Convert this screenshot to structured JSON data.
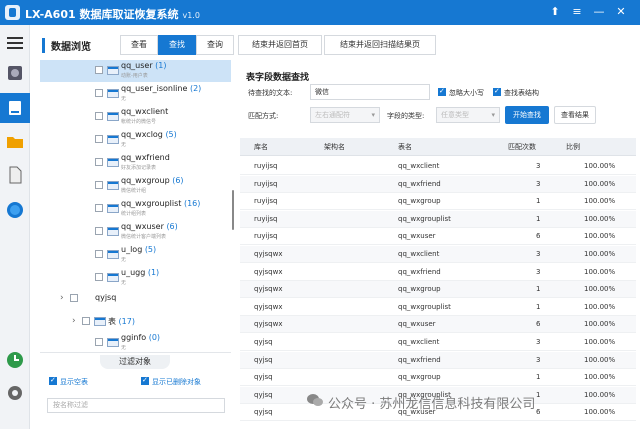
{
  "app": {
    "title": "LX-A601 数据库取证恢复系统",
    "version": "v1.0"
  },
  "window_controls": {
    "pin": "⬆",
    "menu": "≡",
    "minimize": "—",
    "close": "✕"
  },
  "leftbar_icons": [
    "menu-icon",
    "disk-icon",
    "drive-icon",
    "folder-icon",
    "document-icon",
    "globe-icon",
    "clock-icon",
    "settings-icon"
  ],
  "nav": {
    "title": "数据浏览",
    "tabs": [
      "查看",
      "查找",
      "查询",
      "结束并返回首页",
      "结束并返回扫描结果页"
    ],
    "active_tab": "查找"
  },
  "tree": {
    "items": [
      {
        "name": "qq_user",
        "count": "(1)",
        "desc": "动账-用户表"
      },
      {
        "name": "qq_user_isonline",
        "count": "(2)",
        "desc": "无"
      },
      {
        "name": "qq_wxclient",
        "count": "",
        "desc": "帐统计的微信号"
      },
      {
        "name": "qq_wxclog",
        "count": "(5)",
        "desc": "无"
      },
      {
        "name": "qq_wxfriend",
        "count": "",
        "desc": "好友添加记录表"
      },
      {
        "name": "qq_wxgroup",
        "count": "(6)",
        "desc": "微信统计组"
      },
      {
        "name": "qq_wxgrouplist",
        "count": "(16)",
        "desc": "统计组列表"
      },
      {
        "name": "qq_wxuser",
        "count": "(6)",
        "desc": "微信统计客户端列表"
      },
      {
        "name": "u_log",
        "count": "(5)",
        "desc": "无"
      },
      {
        "name": "u_ugg",
        "count": "(1)",
        "desc": "无"
      }
    ],
    "db_node": "qyjsq",
    "table_node": "表",
    "table_count": "(17)",
    "last_item": {
      "name": "gginfo",
      "count": "(0)",
      "desc": "无"
    }
  },
  "filter": {
    "title": "过滤对象",
    "show_empty_label": "显示空表",
    "show_deleted_label": "显示已删除对象",
    "search_placeholder": "按名称过滤"
  },
  "search": {
    "title": "表字段数据查找",
    "text_label": "待查找的文本:",
    "text_value": "微信",
    "ignore_case_label": "忽略大小写",
    "find_struct_label": "查找表结构",
    "match_label": "匹配方式:",
    "match_value": "左右通配符",
    "type_label": "字段的类型:",
    "type_value": "任意类型",
    "start_button": "开始查找",
    "view_button": "查看结果"
  },
  "results": {
    "columns": [
      "库名",
      "架构名",
      "表名",
      "匹配次数",
      "比例"
    ],
    "rows": [
      [
        "ruyijsq",
        "",
        "qq_wxclient",
        "3",
        "100.00%"
      ],
      [
        "ruyijsq",
        "",
        "qq_wxfriend",
        "3",
        "100.00%"
      ],
      [
        "ruyijsq",
        "",
        "qq_wxgroup",
        "1",
        "100.00%"
      ],
      [
        "ruyijsq",
        "",
        "qq_wxgrouplist",
        "1",
        "100.00%"
      ],
      [
        "ruyijsq",
        "",
        "qq_wxuser",
        "6",
        "100.00%"
      ],
      [
        "qyjsqwx",
        "",
        "qq_wxclient",
        "3",
        "100.00%"
      ],
      [
        "qyjsqwx",
        "",
        "qq_wxfriend",
        "3",
        "100.00%"
      ],
      [
        "qyjsqwx",
        "",
        "qq_wxgroup",
        "1",
        "100.00%"
      ],
      [
        "qyjsqwx",
        "",
        "qq_wxgrouplist",
        "1",
        "100.00%"
      ],
      [
        "qyjsqwx",
        "",
        "qq_wxuser",
        "6",
        "100.00%"
      ],
      [
        "qyjsq",
        "",
        "qq_wxclient",
        "3",
        "100.00%"
      ],
      [
        "qyjsq",
        "",
        "qq_wxfriend",
        "3",
        "100.00%"
      ],
      [
        "qyjsq",
        "",
        "qq_wxgroup",
        "1",
        "100.00%"
      ],
      [
        "qyjsq",
        "",
        "qq_wxgrouplist",
        "1",
        "100.00%"
      ],
      [
        "qyjsq",
        "",
        "qq_wxuser",
        "6",
        "100.00%"
      ]
    ]
  },
  "watermark": "公众号 · 苏州龙信信息科技有限公司",
  "colors": {
    "accent": "#1678d2",
    "selected_row": "#cde3f7"
  }
}
